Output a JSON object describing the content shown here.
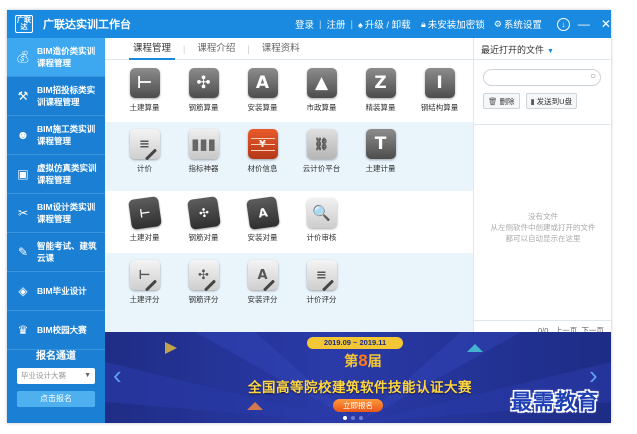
{
  "app": {
    "logo_text": "广联达",
    "title": "广联达实训工作台"
  },
  "titlebar": {
    "login": "登录",
    "sep": "|",
    "register": "注册",
    "upgrade": "升级 / 卸载",
    "no_key": "未安装加密锁",
    "settings": "系统设置"
  },
  "sidebar": {
    "items": [
      {
        "label": "BIM造价类实训课程管理",
        "icon": "money-bag-icon"
      },
      {
        "label": "BIM招投标类实训课程管理",
        "icon": "gavel-icon"
      },
      {
        "label": "BIM施工类实训课程管理",
        "icon": "worker-icon"
      },
      {
        "label": "虚拟仿真类实训课程管理",
        "icon": "vr-cube-icon"
      },
      {
        "label": "BIM设计类实训课程管理",
        "icon": "tools-icon"
      },
      {
        "label": "智能考试、建筑云课",
        "icon": "exam-icon"
      },
      {
        "label": "BIM毕业设计",
        "icon": "layers-icon"
      },
      {
        "label": "BIM校园大赛",
        "icon": "trophy-icon"
      }
    ],
    "registration": {
      "title": "报名通道",
      "select_placeholder": "毕业设计大赛",
      "button": "点击报名"
    }
  },
  "tabs": [
    {
      "label": "课程管理",
      "active": true
    },
    {
      "label": "课程介绍",
      "active": false
    },
    {
      "label": "课程资料",
      "active": false
    }
  ],
  "grid": {
    "rows": [
      [
        {
          "label": "土建算量",
          "glyph": "⊢",
          "style": "gray"
        },
        {
          "label": "钢筋算量",
          "glyph": "✣",
          "style": "gray"
        },
        {
          "label": "安装算量",
          "glyph": "A",
          "style": "gray"
        },
        {
          "label": "市政算量",
          "glyph": "▲",
          "style": "gray"
        },
        {
          "label": "精装算量",
          "glyph": "Z",
          "style": "gray"
        },
        {
          "label": "钢结构算量",
          "glyph": "I",
          "style": "gray"
        }
      ],
      [
        {
          "label": "计价",
          "glyph": "≡",
          "style": "doc"
        },
        {
          "label": "指标神器",
          "glyph": "▮▮▮",
          "style": "cloud"
        },
        {
          "label": "材价信息",
          "glyph": "¥",
          "style": "bricks"
        },
        {
          "label": "云计价平台",
          "glyph": "⛓",
          "style": "calc"
        },
        {
          "label": "土建计量",
          "glyph": "T",
          "style": "gray"
        }
      ],
      [
        {
          "label": "土建对量",
          "glyph": "⊢",
          "style": "card"
        },
        {
          "label": "钢筋对量",
          "glyph": "✣",
          "style": "card"
        },
        {
          "label": "安装对量",
          "glyph": "A",
          "style": "card"
        },
        {
          "label": "计价审核",
          "glyph": "🔍",
          "style": "magnify"
        }
      ],
      [
        {
          "label": "土建评分",
          "glyph": "⊢",
          "style": "doc"
        },
        {
          "label": "钢筋评分",
          "glyph": "✣",
          "style": "doc"
        },
        {
          "label": "安装评分",
          "glyph": "A",
          "style": "doc"
        },
        {
          "label": "计价评分",
          "glyph": "≡",
          "style": "doc"
        }
      ]
    ]
  },
  "right_panel": {
    "title": "最近打开的文件",
    "search_placeholder": "",
    "delete": "删除",
    "send_usb": "发送到U盘",
    "empty_line1": "没有文件",
    "empty_line2": "从左侧软件中创建或打开的文件",
    "empty_line3": "都可以自动显示在这里",
    "pager_count": "0/0",
    "pager_prev": "上一页",
    "pager_next": "下一页"
  },
  "banner": {
    "date_range": "2019.09 ~ 2019.11",
    "edition_prefix": "第",
    "edition_num": "8",
    "edition_suffix": "届",
    "title": "全国高等院校建筑软件技能认证大赛",
    "cta": "立即报名"
  },
  "watermark": "最需教育",
  "colors": {
    "titlebar": "#1a8ae0",
    "sidebar": "#1b7fd3",
    "sidebar_active": "#3da8f0",
    "banner_bg": "#1f2d86",
    "banner_text": "#ffd640"
  }
}
